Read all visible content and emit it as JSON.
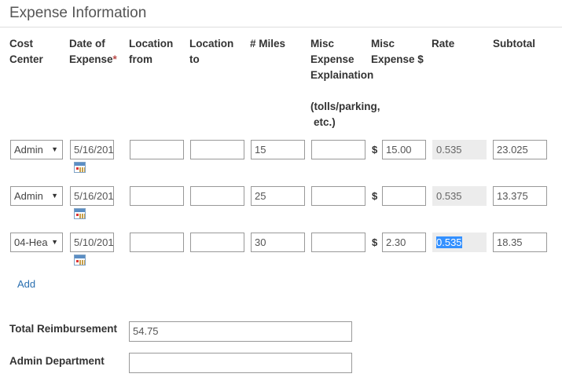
{
  "section_title": "Expense Information",
  "headers": {
    "cost_center": [
      "Cost",
      "Center"
    ],
    "date": [
      "Date of",
      "Expense"
    ],
    "required_mark": "*",
    "location_from": [
      "Location",
      "from"
    ],
    "location_to": [
      "Location",
      "to"
    ],
    "miles": [
      "# Miles"
    ],
    "misc_expl": [
      "Misc",
      "Expense",
      "Explaination",
      "",
      "(tolls/parking,",
      " etc.)"
    ],
    "misc_amt": [
      "Misc",
      "Expense $"
    ],
    "rate": [
      "Rate"
    ],
    "subtotal": [
      "Subtotal"
    ]
  },
  "currency_symbol": "$",
  "rows": [
    {
      "cost_center": "Admin",
      "date": "5/16/201",
      "location_from": "",
      "location_to": "",
      "miles": "15",
      "misc_expl": "",
      "misc_amt": "15.00",
      "rate": "0.535",
      "subtotal": "23.025"
    },
    {
      "cost_center": "Admin",
      "date": "5/16/201",
      "location_from": "",
      "location_to": "",
      "miles": "25",
      "misc_expl": "",
      "misc_amt": "",
      "rate": "0.535",
      "subtotal": "13.375"
    },
    {
      "cost_center": "04-Hea",
      "date": "5/10/201",
      "location_from": "",
      "location_to": "",
      "miles": "30",
      "misc_expl": "",
      "misc_amt": "2.30",
      "rate": "0.535",
      "subtotal": "18.35"
    }
  ],
  "add_label": "Add",
  "total_label": "Total Reimbursement",
  "total_value": "54.75",
  "admin_label": "Admin Department",
  "admin_value": ""
}
